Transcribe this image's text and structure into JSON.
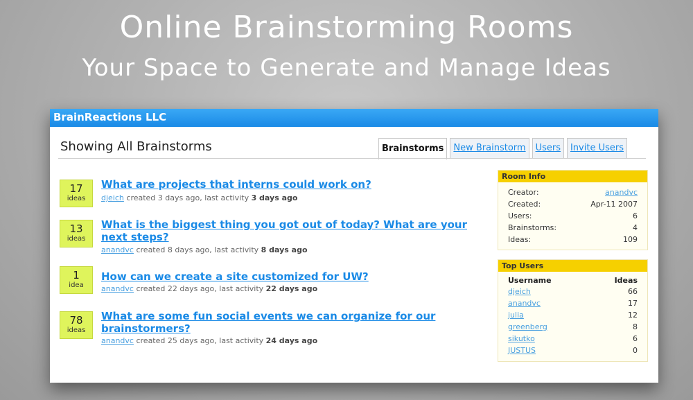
{
  "hero": {
    "title": "Online Brainstorming Rooms",
    "subtitle": "Your Space to Generate and Manage Ideas"
  },
  "window": {
    "company": "BrainReactions LLC",
    "page_title": "Showing All Brainstorms"
  },
  "tabs": [
    {
      "label": "Brainstorms",
      "active": true
    },
    {
      "label": "New Brainstorm",
      "active": false
    },
    {
      "label": "Users",
      "active": false
    },
    {
      "label": "Invite Users",
      "active": false
    }
  ],
  "ideas": [
    {
      "count": "17",
      "count_label": "ideas",
      "title": "What are projects that interns could work on?",
      "user": "djeich",
      "created": "created 3 days ago, last activity",
      "last_activity": "3 days ago"
    },
    {
      "count": "13",
      "count_label": "ideas",
      "title": "What is the biggest thing you got out of today? What are your next steps?",
      "user": "anandvc",
      "created": "created 8 days ago, last activity",
      "last_activity": "8 days ago"
    },
    {
      "count": "1",
      "count_label": "idea",
      "title": "How can we create a site customized for UW?",
      "user": "anandvc",
      "created": "created 22 days ago, last activity",
      "last_activity": "22 days ago"
    },
    {
      "count": "78",
      "count_label": "ideas",
      "title": "What are some fun social events we can organize for our brainstormers?",
      "user": "anandvc",
      "created": "created 25 days ago, last activity",
      "last_activity": "24 days ago"
    }
  ],
  "room_info": {
    "header": "Room Info",
    "rows": [
      {
        "key": "Creator:",
        "value": "anandvc"
      },
      {
        "key": "Created:",
        "value": "Apr-11 2007"
      },
      {
        "key": "Users:",
        "value": "6"
      },
      {
        "key": "Brainstorms:",
        "value": "4"
      },
      {
        "key": "Ideas:",
        "value": "109"
      }
    ]
  },
  "top_users": {
    "header": "Top Users",
    "col_username": "Username",
    "col_ideas": "Ideas",
    "rows": [
      {
        "username": "djeich",
        "ideas": "66"
      },
      {
        "username": "anandvc",
        "ideas": "17"
      },
      {
        "username": "julia",
        "ideas": "12"
      },
      {
        "username": "greenberg",
        "ideas": "8"
      },
      {
        "username": "sikutko",
        "ideas": "6"
      },
      {
        "username": "JUSTUS",
        "ideas": "0"
      }
    ]
  }
}
